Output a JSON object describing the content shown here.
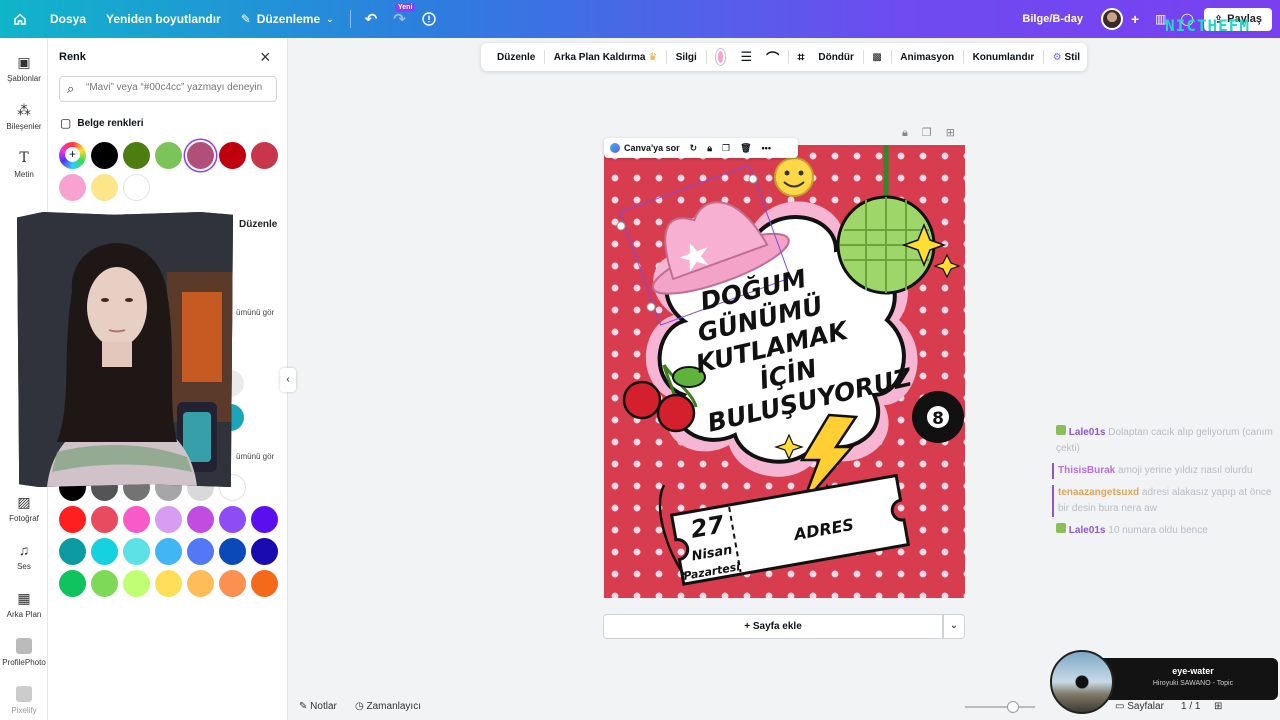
{
  "topbar": {
    "file": "Dosya",
    "resize": "Yeniden boyutlandır",
    "edit": "Düzenleme",
    "new_badge": "Yeni",
    "doc_title": "Bilge/B-day",
    "share": "Paylaş",
    "overlay_brand": "NICTHEFM"
  },
  "rail": {
    "items": [
      "Şablonlar",
      "Bileşenler",
      "Metin",
      "Fotoğraf",
      "Ses",
      "Arka Plan",
      "ProfilePhoto",
      "Pixelify"
    ]
  },
  "panel": {
    "title": "Renk",
    "search_placeholder": "“Mavi” veya “#00c4cc” yazmayı deneyin",
    "doc_colors_label": "Belge renkleri",
    "edit_label": "Düzenle",
    "see_all_1": "ümünü gör",
    "see_all_2": "ümünü gör",
    "doc_colors": [
      "#000000",
      "#4d7c0f",
      "#7cc45a",
      "#b0507a",
      "#c1000f",
      "#c7364a",
      "#f7a2d0",
      "#fde68a",
      "#ffffff"
    ],
    "default_rows": [
      [
        "#000000",
        "#545454",
        "#737373",
        "#a6a6a6",
        "#d9d9d9",
        "#ffffff"
      ],
      [
        "#ff1f1f",
        "#e84a5f",
        "#f85ac9",
        "#d89cf2",
        "#c04ddf",
        "#8d4cf5",
        "#5a0ff0"
      ],
      [
        "#0c9ba2",
        "#16d1e0",
        "#5ce1e6",
        "#40b6f5",
        "#5278f8",
        "#0a4ab8",
        "#1a0bb0"
      ],
      [
        "#0fc35e",
        "#7ed957",
        "#c1ff72",
        "#ffde59",
        "#ffbd59",
        "#fa9150",
        "#f56a1a"
      ]
    ]
  },
  "toolbar": {
    "items": [
      "Düzenle",
      "Arka Plan Kaldırma",
      "Silgi",
      "Döndür",
      "Animasyon",
      "Konumlandır",
      "Stil"
    ]
  },
  "canvas": {
    "ask_canva": "Canva'ya sor",
    "headline_lines": [
      "DOĞUM",
      "GÜNÜMÜ",
      "KUTLAMAK",
      "İÇİN",
      "BULUŞUYORUZ"
    ],
    "date_day": "27",
    "date_month": "Nisan",
    "date_weekday": "Pazartesi",
    "address": "ADRES",
    "ball_number": "8",
    "add_page": "+ Sayfa ekle"
  },
  "bottombar": {
    "notes": "Notlar",
    "timer": "Zamanlayıcı",
    "pages": "Sayfalar",
    "page_count": "1 / 1"
  },
  "chat": [
    {
      "user": "Lale01s",
      "user_color": "#8b57d6",
      "text": "Dolaptan cacık alıp geliyorum (canım çekti)",
      "highlight": false
    },
    {
      "user": "ThisisBurak",
      "user_color": "#b86fe0",
      "text": "amoji yerine yıldız nasıl olurdu",
      "highlight": true
    },
    {
      "user": "tenaazangetsuxd",
      "user_color": "#e0a35c",
      "text": "adresi alakasız yapıp at önce bir desin bura nera aw",
      "highlight": true
    },
    {
      "user": "Lale01s",
      "user_color": "#8b57d6",
      "text": "10 numara oldu bence",
      "highlight": false
    }
  ],
  "music": {
    "title": "eye-water",
    "artist": "Hiroyuki SAWANO - Topic"
  }
}
